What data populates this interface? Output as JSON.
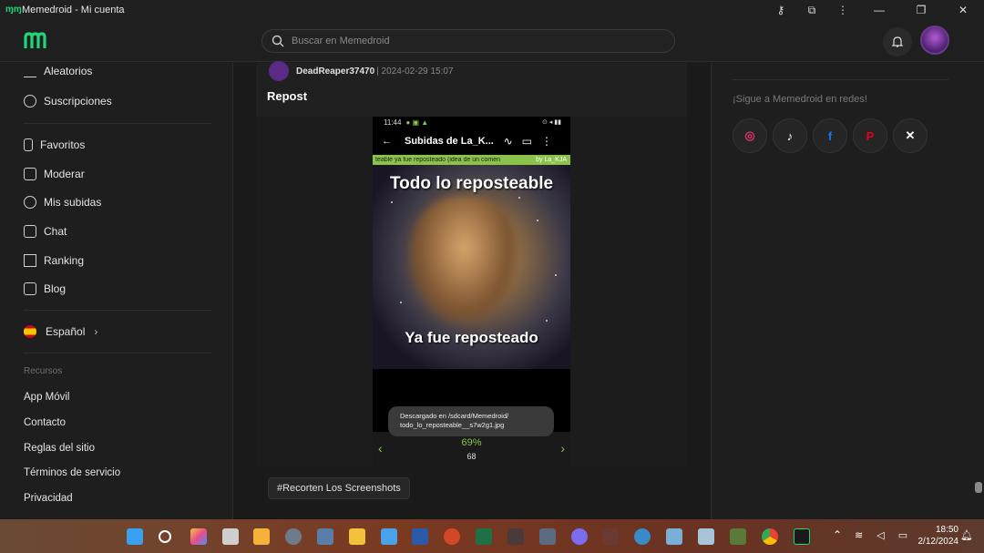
{
  "window": {
    "title": "Memedroid - Mi cuenta",
    "controls": [
      "—",
      "❐",
      "✕"
    ]
  },
  "header": {
    "search_placeholder": "Buscar en Memedroid"
  },
  "sidebar": {
    "items": [
      {
        "label": "Aleatorios"
      },
      {
        "label": "Suscripciones"
      },
      {
        "label": "Favoritos"
      },
      {
        "label": "Moderar"
      },
      {
        "label": "Mis subidas"
      },
      {
        "label": "Chat"
      },
      {
        "label": "Ranking"
      },
      {
        "label": "Blog"
      }
    ],
    "language": "Español",
    "resources_title": "Recursos",
    "links": [
      "App Móvil",
      "Contacto",
      "Reglas del sitio",
      "Términos de servicio",
      "Privacidad"
    ]
  },
  "post": {
    "author": "DeadReaper37470",
    "date": "| 2024-02-29 15:07",
    "title": "Repost",
    "phone": {
      "time": "11:44",
      "app_title": "Subidas de La_K...",
      "banner_left": "teable ya fue reposteado (idea de un comen",
      "banner_right": "by La_KJA",
      "meme_top": "Todo lo reposteable",
      "meme_bottom": "Ya fue reposteado",
      "toast_line1": "Descargado en /sdcard/Memedroid/",
      "toast_line2": "todo_lo_reposteable__s7w2g1.jpg",
      "percent": "69%",
      "count": "68"
    },
    "tag": "#Recorten Los Screenshots"
  },
  "right_panel": {
    "follow_text": "¡Sigue a Memedroid en redes!"
  },
  "taskbar": {
    "time": "18:50",
    "date": "2/12/2024"
  },
  "colors": {
    "accent": "#8bc34a",
    "brand": "#1fd67a"
  }
}
